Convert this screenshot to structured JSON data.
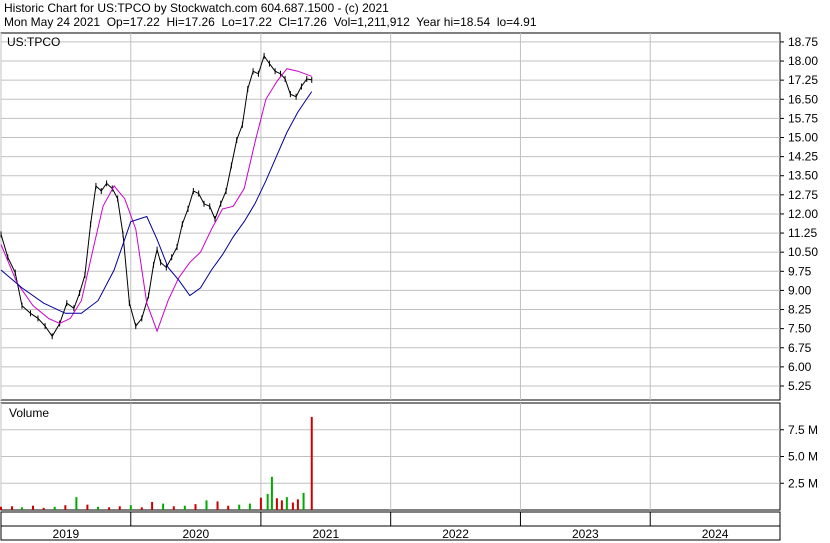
{
  "header": {
    "line1": "Historic Chart for US:TPCO by Stockwatch.com 604.687.1500 - (c) 2021",
    "line2": "Mon May 24 2021  Op=17.22  Hi=17.26  Lo=17.22  Cl=17.26  Vol=1,211,912  Year hi=18.54  lo=4.91"
  },
  "colors": {
    "price": "#000000",
    "ma_short": "#cc00cc",
    "ma_long": "#000099",
    "grid": "#c0c0c0",
    "volume_up": "#00aa00",
    "volume_down": "#cc0000"
  },
  "chart_data": [
    {
      "type": "line",
      "panel_label": "US:TPCO",
      "y_axis_side": "right",
      "ylim": [
        4.7,
        19.1
      ],
      "y_ticks": [
        "18.75",
        "18.00",
        "17.25",
        "16.50",
        "15.75",
        "15.00",
        "14.25",
        "13.50",
        "12.75",
        "12.00",
        "11.25",
        "10.50",
        "9.75",
        "9.00",
        "8.25",
        "7.50",
        "6.75",
        "6.00",
        "5.25"
      ],
      "x_ticks": [
        "2019",
        "2020",
        "2021",
        "2022",
        "2023",
        "2024"
      ],
      "x_range": [
        "2019-01-01",
        "2024-12-31"
      ],
      "grid": true,
      "series": [
        {
          "style": "price-high-low",
          "x": [
            "2019-01-01",
            "2019-01-20",
            "2019-02-10",
            "2019-03-01",
            "2019-03-25",
            "2019-04-15",
            "2019-05-05",
            "2019-05-25",
            "2019-06-15",
            "2019-07-05",
            "2019-07-25",
            "2019-08-10",
            "2019-08-25",
            "2019-09-10",
            "2019-09-25",
            "2019-10-10",
            "2019-10-25",
            "2019-11-10",
            "2019-11-25",
            "2019-12-10",
            "2019-12-28",
            "2020-01-15",
            "2020-02-01",
            "2020-02-20",
            "2020-03-05",
            "2020-03-15",
            "2020-03-25",
            "2020-04-10",
            "2020-04-25",
            "2020-05-10",
            "2020-05-25",
            "2020-06-10",
            "2020-06-25",
            "2020-07-10",
            "2020-07-25",
            "2020-08-10",
            "2020-08-25",
            "2020-09-10",
            "2020-09-25",
            "2020-10-10",
            "2020-10-25",
            "2020-11-10",
            "2020-11-25",
            "2020-12-10",
            "2020-12-25",
            "2021-01-10",
            "2021-01-25",
            "2021-02-10",
            "2021-02-25",
            "2021-03-10",
            "2021-03-25",
            "2021-04-10",
            "2021-04-25",
            "2021-05-10",
            "2021-05-24"
          ],
          "y": [
            11.2,
            10.3,
            9.7,
            8.4,
            8.1,
            7.9,
            7.6,
            7.2,
            7.7,
            8.5,
            8.3,
            8.9,
            9.6,
            11.6,
            13.1,
            12.9,
            13.2,
            13.0,
            12.6,
            11.2,
            8.5,
            7.6,
            7.9,
            8.8,
            10.0,
            10.6,
            10.1,
            9.9,
            10.3,
            10.7,
            11.6,
            12.2,
            12.9,
            12.8,
            12.4,
            12.3,
            11.8,
            12.4,
            12.9,
            13.9,
            14.9,
            15.5,
            16.9,
            17.6,
            17.5,
            18.2,
            17.9,
            17.6,
            17.5,
            17.3,
            16.7,
            16.6,
            17.0,
            17.3,
            17.26
          ]
        },
        {
          "style": "moving-average",
          "x": [
            "2019-01-01",
            "2019-02-15",
            "2019-04-01",
            "2019-05-15",
            "2019-06-15",
            "2019-07-15",
            "2019-08-15",
            "2019-09-15",
            "2019-10-15",
            "2019-11-15",
            "2019-12-15",
            "2020-01-15",
            "2020-02-15",
            "2020-03-15",
            "2020-04-15",
            "2020-05-15",
            "2020-06-15",
            "2020-07-15",
            "2020-08-15",
            "2020-09-15",
            "2020-10-15",
            "2020-11-15",
            "2020-12-15",
            "2021-01-15",
            "2021-02-15",
            "2021-03-15",
            "2021-04-15",
            "2021-05-24"
          ],
          "y": [
            10.8,
            9.3,
            8.4,
            7.9,
            7.7,
            7.9,
            8.6,
            10.5,
            12.3,
            13.1,
            12.6,
            11.4,
            8.5,
            7.4,
            8.6,
            9.5,
            10.1,
            10.5,
            11.4,
            12.2,
            12.3,
            13.0,
            14.8,
            16.5,
            17.2,
            17.7,
            17.6,
            17.4
          ]
        },
        {
          "style": "moving-average",
          "x": [
            "2019-01-01",
            "2019-03-01",
            "2019-05-01",
            "2019-07-01",
            "2019-08-15",
            "2019-10-01",
            "2019-11-15",
            "2020-01-01",
            "2020-02-15",
            "2020-03-15",
            "2020-04-15",
            "2020-05-15",
            "2020-06-15",
            "2020-07-15",
            "2020-08-15",
            "2020-09-15",
            "2020-10-15",
            "2020-11-15",
            "2020-12-15",
            "2021-01-15",
            "2021-02-15",
            "2021-03-15",
            "2021-04-15",
            "2021-05-24"
          ],
          "y": [
            9.8,
            9.1,
            8.5,
            8.1,
            8.1,
            8.6,
            9.8,
            11.7,
            11.9,
            11.0,
            9.9,
            9.4,
            8.8,
            9.1,
            9.8,
            10.4,
            11.1,
            11.7,
            12.4,
            13.3,
            14.3,
            15.2,
            16.0,
            16.8
          ]
        }
      ]
    },
    {
      "type": "bar",
      "panel_label": "Volume",
      "y_axis_side": "right",
      "ylim": [
        0,
        10000000
      ],
      "y_ticks": [
        "7.5 M",
        "5.0 M",
        "2.5 M"
      ],
      "x_range": [
        "2019-01-01",
        "2024-12-31"
      ],
      "grid": true,
      "x": [
        "2019-01-01",
        "2019-02-01",
        "2019-03-01",
        "2019-04-01",
        "2019-05-01",
        "2019-06-01",
        "2019-07-01",
        "2019-08-01",
        "2019-09-01",
        "2019-10-01",
        "2019-11-01",
        "2019-12-01",
        "2020-01-01",
        "2020-02-01",
        "2020-03-01",
        "2020-04-01",
        "2020-05-01",
        "2020-06-01",
        "2020-07-01",
        "2020-08-01",
        "2020-09-01",
        "2020-10-01",
        "2020-11-01",
        "2020-12-01",
        "2021-01-01",
        "2021-01-20",
        "2021-02-01",
        "2021-02-15",
        "2021-03-01",
        "2021-03-15",
        "2021-04-01",
        "2021-04-15",
        "2021-05-01",
        "2021-05-24"
      ],
      "values": [
        300000,
        350000,
        250000,
        400000,
        200000,
        300000,
        450000,
        1200000,
        500000,
        300000,
        250000,
        350000,
        450000,
        250000,
        750000,
        600000,
        350000,
        400000,
        550000,
        900000,
        800000,
        400000,
        500000,
        600000,
        1150000,
        1500000,
        3100000,
        1100000,
        900000,
        1200000,
        700000,
        1000000,
        1600000,
        8700000
      ],
      "colors": [
        "volume_down",
        "volume_down",
        "volume_up",
        "volume_down",
        "volume_down",
        "volume_up",
        "volume_down",
        "volume_up",
        "volume_down",
        "volume_up",
        "volume_down",
        "volume_down",
        "volume_up",
        "volume_down",
        "volume_down",
        "volume_up",
        "volume_down",
        "volume_up",
        "volume_down",
        "volume_up",
        "volume_down",
        "volume_down",
        "volume_up",
        "volume_up",
        "volume_down",
        "volume_up",
        "volume_up",
        "volume_down",
        "volume_down",
        "volume_up",
        "volume_down",
        "volume_down",
        "volume_up",
        "volume_down"
      ]
    }
  ]
}
